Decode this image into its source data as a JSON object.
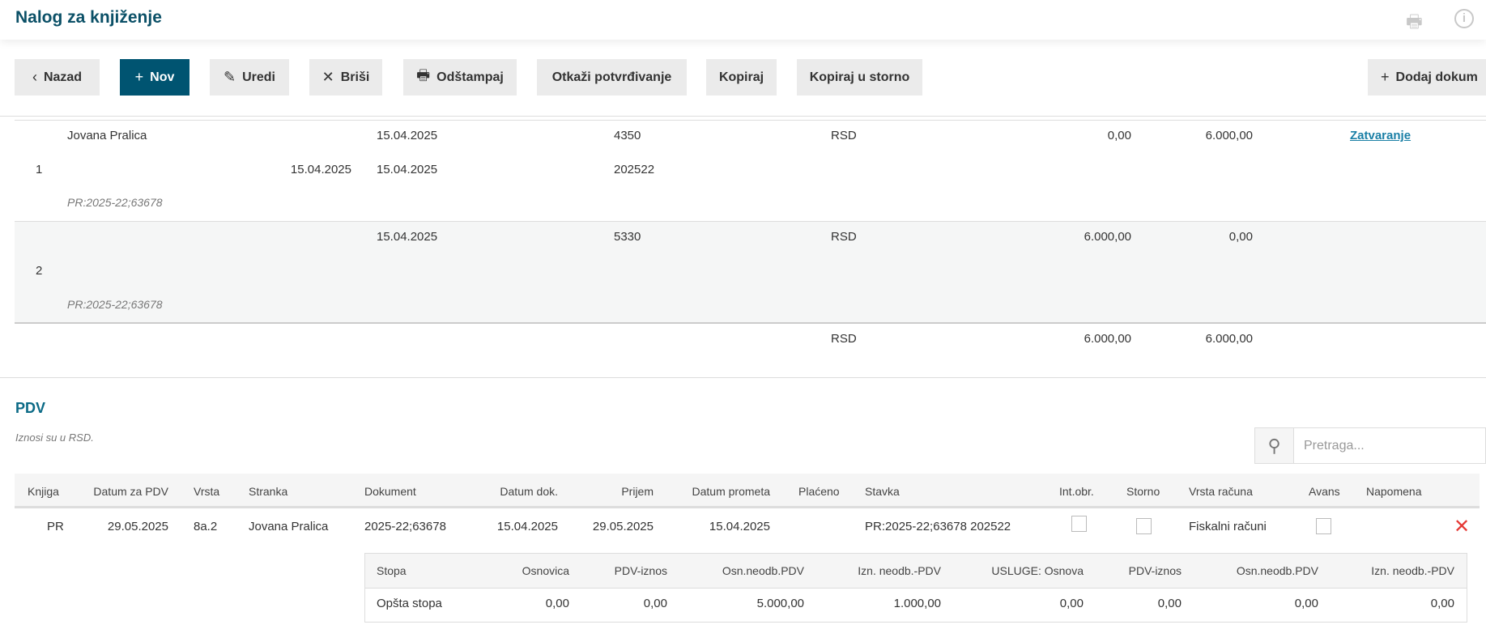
{
  "header": {
    "title": "Nalog za knjiženje",
    "print_icon": "printer-icon",
    "info_icon": "info-icon"
  },
  "toolbar": {
    "back": "Nazad",
    "new": "Nov",
    "edit": "Uredi",
    "delete": "Briši",
    "print": "Odštampaj",
    "cancel_confirm": "Otkaži potvrđivanje",
    "copy": "Kopiraj",
    "copy_storno": "Kopiraj u storno",
    "add_doc": "Dodaj dokum"
  },
  "entries": [
    {
      "no": "1",
      "party": "Jovana Pralica",
      "date_due": "15.04.2025",
      "date1": "15.04.2025",
      "date2": "15.04.2025",
      "account1": "4350",
      "account2": "202522",
      "currency": "RSD",
      "debit": "0,00",
      "credit": "6.000,00",
      "link": "Zatvaranje",
      "ref": "PR:2025-22;63678"
    },
    {
      "no": "2",
      "party": "",
      "date_due": "",
      "date1": "15.04.2025",
      "date2": "",
      "account1": "5330",
      "account2": "",
      "currency": "RSD",
      "debit": "6.000,00",
      "credit": "0,00",
      "link": "",
      "ref": "PR:2025-22;63678"
    }
  ],
  "totals": {
    "currency": "RSD",
    "debit": "6.000,00",
    "credit": "6.000,00"
  },
  "pdv": {
    "title": "PDV",
    "note": "Iznosi su u RSD.",
    "search_placeholder": "Pretraga...",
    "columns": [
      "Knjiga",
      "Datum za PDV",
      "Vrsta",
      "Stranka",
      "Dokument",
      "Datum dok.",
      "Prijem",
      "Datum prometa",
      "Plaćeno",
      "Stavka",
      "Int.obr.",
      "Storno",
      "Vrsta računa",
      "Avans",
      "Napomena"
    ],
    "row": {
      "knjiga": "PR",
      "datum_pdv": "29.05.2025",
      "vrsta": "8a.2",
      "stranka": "Jovana Pralica",
      "dokument": "2025-22;63678",
      "datum_dok": "15.04.2025",
      "prijem": "29.05.2025",
      "datum_prometa": "15.04.2025",
      "placeno": "",
      "stavka": "PR:2025-22;63678 202522",
      "int_obr": false,
      "storno": false,
      "vrsta_racuna": "Fiskalni računi",
      "avans": false,
      "napomena": ""
    },
    "delete_color": "#e53935",
    "rates": {
      "columns": [
        "Stopa",
        "Osnovica",
        "PDV-iznos",
        "Osn.neodb.PDV",
        "Izn. neodb.-PDV",
        "USLUGE: Osnova",
        "PDV-iznos",
        "Osn.neodb.PDV",
        "Izn. neodb.-PDV"
      ],
      "row": [
        "Opšta stopa",
        "0,00",
        "0,00",
        "5.000,00",
        "1.000,00",
        "0,00",
        "0,00",
        "0,00",
        "0,00"
      ]
    }
  },
  "colors": {
    "brand": "#005471",
    "title": "#0b5067",
    "link": "#1a7fa6"
  }
}
